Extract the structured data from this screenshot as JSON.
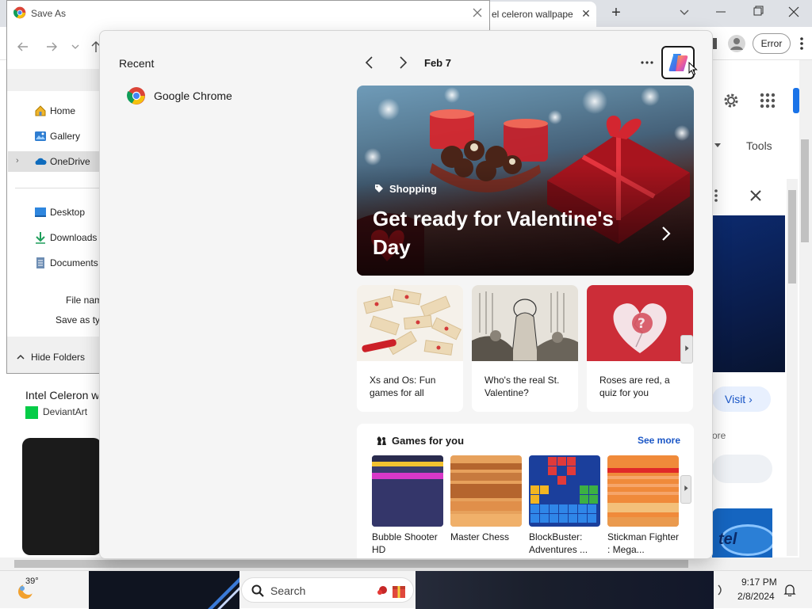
{
  "browser": {
    "tab_title": "el celeron wallpape",
    "new_tab_symbol": "+",
    "toolbar": {
      "error_label": "Error",
      "tools_label": "Tools"
    },
    "side_panel": {
      "visit_label": "Visit",
      "more_fragment": "ore",
      "intel_fragment": "tel"
    },
    "result": {
      "title": "Intel Celeron w",
      "source": "DeviantArt"
    }
  },
  "save_as": {
    "title": "Save As",
    "sidebar": [
      {
        "label": "Home",
        "icon": "home-icon"
      },
      {
        "label": "Gallery",
        "icon": "gallery-icon"
      },
      {
        "label": "OneDrive",
        "icon": "onedrive-icon",
        "selected": true
      },
      {
        "label": "Desktop",
        "icon": "desktop-icon"
      },
      {
        "label": "Downloads",
        "icon": "downloads-icon"
      },
      {
        "label": "Documents",
        "icon": "documents-icon"
      }
    ],
    "file_name_label": "File name",
    "save_as_type_label": "Save as type",
    "hide_folders_label": "Hide Folders"
  },
  "widgets": {
    "recent_title": "Recent",
    "recent_items": [
      {
        "label": "Google Chrome",
        "icon": "chrome-icon"
      }
    ],
    "date": "Feb 7",
    "hero": {
      "category": "Shopping",
      "title": "Get ready for Valentine's Day"
    },
    "cards": [
      {
        "caption": "Xs and Os: Fun games for all"
      },
      {
        "caption": "Who's the real St. Valentine?"
      },
      {
        "caption": "Roses are red, a quiz for you"
      }
    ],
    "games": {
      "title": "Games for you",
      "see_more": "See more",
      "items": [
        {
          "name": "Bubble Shooter HD"
        },
        {
          "name": "Master Chess"
        },
        {
          "name": "BlockBuster: Adventures ..."
        },
        {
          "name": "Stickman Fighter : Mega..."
        }
      ]
    }
  },
  "taskbar": {
    "temperature": "39°",
    "search_placeholder": "Search",
    "time": "9:17 PM",
    "date": "2/8/2024"
  },
  "colors": {
    "accent_blue": "#1a56c6",
    "chrome_blue": "#1a73e8",
    "hero_red": "#b3141c"
  }
}
